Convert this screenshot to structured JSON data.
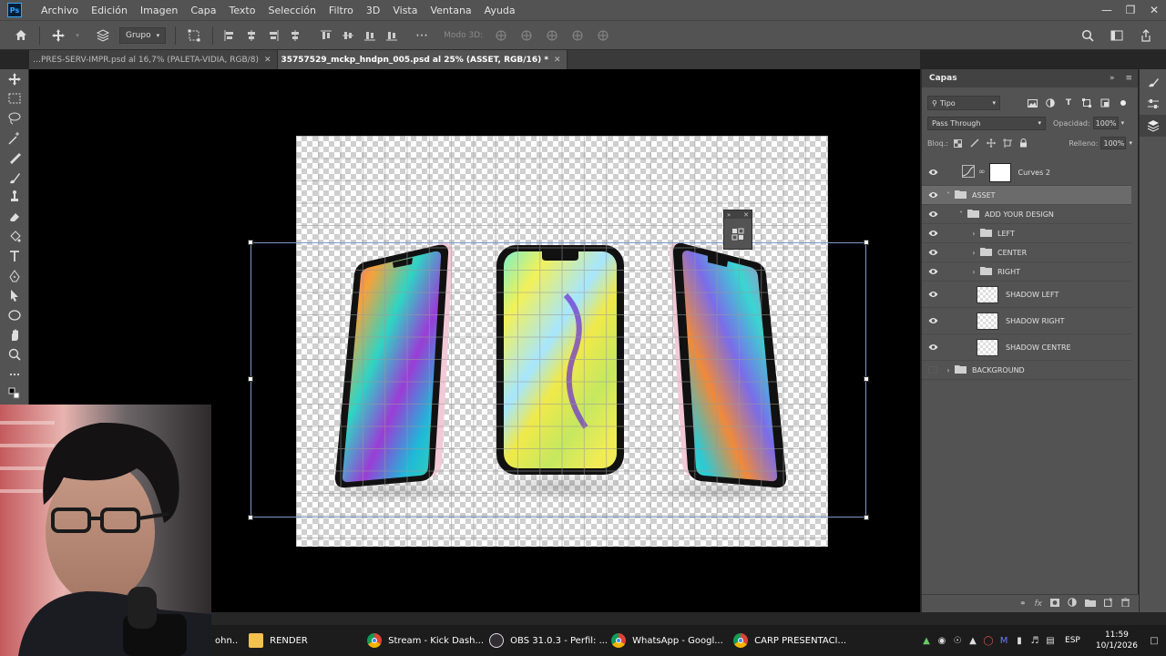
{
  "app": {
    "logo": "Ps"
  },
  "menubar": {
    "items": [
      "Archivo",
      "Edición",
      "Imagen",
      "Capa",
      "Texto",
      "Selección",
      "Filtro",
      "3D",
      "Vista",
      "Ventana",
      "Ayuda"
    ]
  },
  "options_bar": {
    "auto_select_value": "Grupo",
    "mode3d_label": "Modo 3D:"
  },
  "tabs": [
    {
      "label": "…PRES-SERV-IMPR.psd al 16,7% (PALETA-VIDIA, RGB/8)",
      "active": false
    },
    {
      "label": "35757529_mckp_hndpn_005.psd al 25% (ASSET, RGB/16) *",
      "active": true
    }
  ],
  "layers_panel": {
    "title": "Capas",
    "filter": "Tipo",
    "blend_mode": "Pass Through",
    "opacity_label": "Opacidad:",
    "opacity_value": "100%",
    "lock_label": "Bloq.:",
    "fill_label": "Relleno:",
    "fill_value": "100%",
    "layers": [
      {
        "name": "Curves 2",
        "kind": "adjustment",
        "indent": 0,
        "visible": true,
        "selected": false
      },
      {
        "name": "ASSET",
        "kind": "group",
        "indent": 0,
        "expanded": true,
        "visible": true,
        "selected": true
      },
      {
        "name": "ADD YOUR DESIGN",
        "kind": "group",
        "indent": 1,
        "expanded": true,
        "visible": true,
        "selected": false
      },
      {
        "name": "LEFT",
        "kind": "group",
        "indent": 2,
        "expanded": false,
        "visible": true,
        "selected": false
      },
      {
        "name": "CENTER",
        "kind": "group",
        "indent": 2,
        "expanded": false,
        "visible": true,
        "selected": false
      },
      {
        "name": "RIGHT",
        "kind": "group",
        "indent": 2,
        "expanded": false,
        "visible": true,
        "selected": false
      },
      {
        "name": "SHADOW LEFT",
        "kind": "pixel",
        "indent": 2,
        "visible": true,
        "selected": false
      },
      {
        "name": "SHADOW RIGHT",
        "kind": "pixel",
        "indent": 2,
        "visible": true,
        "selected": false
      },
      {
        "name": "SHADOW CENTRE",
        "kind": "pixel",
        "indent": 2,
        "visible": true,
        "selected": false
      },
      {
        "name": "BACKGROUND",
        "kind": "group",
        "indent": 0,
        "expanded": false,
        "visible": false,
        "selected": false
      }
    ]
  },
  "taskbar": {
    "cut_label": "ohn..",
    "apps": [
      {
        "label": "RENDER",
        "icon": "folder-icon",
        "color": "#f2c14e"
      },
      {
        "label": "Stream - Kick Dash...",
        "icon": "chrome-icon",
        "color": "#4285f4"
      },
      {
        "label": "OBS 31.0.3 - Perfil: ...",
        "icon": "obs-icon",
        "color": "#302e31"
      },
      {
        "label": "WhatsApp - Googl...",
        "icon": "chrome-icon",
        "color": "#4285f4"
      },
      {
        "label": "CARP PRESENTACI...",
        "icon": "chrome-icon",
        "color": "#4285f4"
      }
    ],
    "lang": "ESP",
    "time": "11:59",
    "date": "10/1/2026"
  },
  "colors": {
    "accent": "#31a8ff",
    "panel": "#535353",
    "canvas_bg": "#000000",
    "selection": "#7a9ac8"
  }
}
